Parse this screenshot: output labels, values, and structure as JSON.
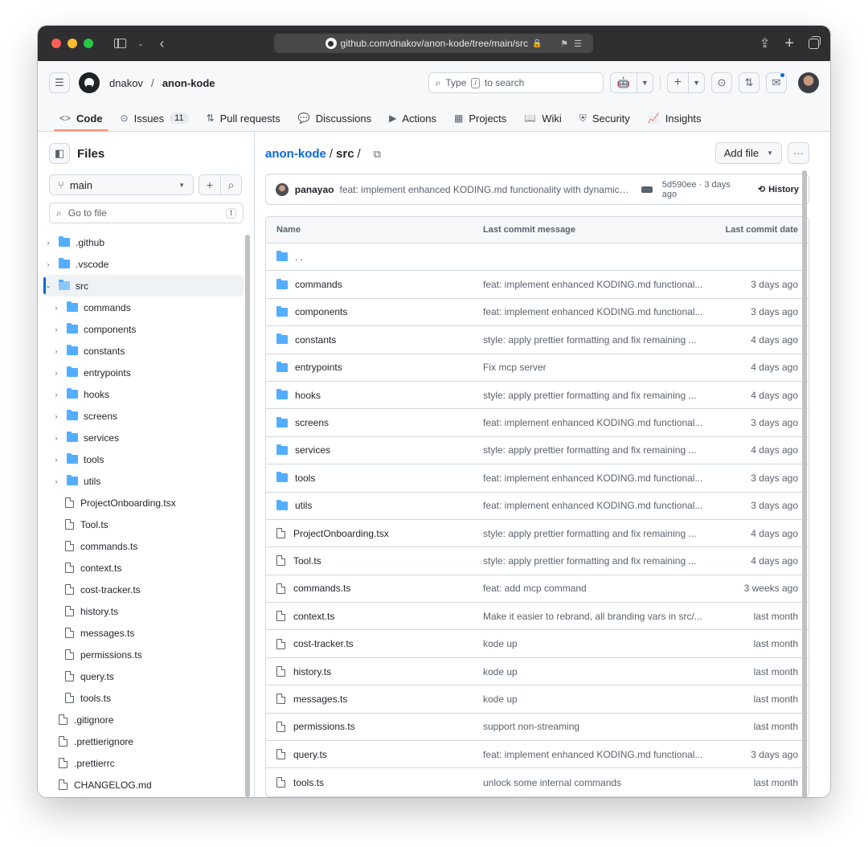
{
  "browser": {
    "url": "github.com/dnakov/anon-kode/tree/main/src"
  },
  "header": {
    "owner": "dnakov",
    "separator": "/",
    "repo": "anon-kode",
    "search_prefix": "Type",
    "search_key": "/",
    "search_suffix": "to search"
  },
  "repo_nav": [
    {
      "label": "Code",
      "icon": "<>"
    },
    {
      "label": "Issues",
      "icon": "⊙",
      "count": "11"
    },
    {
      "label": "Pull requests",
      "icon": "⇅"
    },
    {
      "label": "Discussions",
      "icon": "💬"
    },
    {
      "label": "Actions",
      "icon": "▶"
    },
    {
      "label": "Projects",
      "icon": "▦"
    },
    {
      "label": "Wiki",
      "icon": "📖"
    },
    {
      "label": "Security",
      "icon": "⛨"
    },
    {
      "label": "Insights",
      "icon": "📈"
    }
  ],
  "sidebar": {
    "title": "Files",
    "branch": "main",
    "goto_placeholder": "Go to file",
    "goto_key": "t",
    "tree": [
      {
        "name": ".github",
        "type": "folder",
        "depth": 0,
        "expanded": false
      },
      {
        "name": ".vscode",
        "type": "folder",
        "depth": 0,
        "expanded": false
      },
      {
        "name": "src",
        "type": "folder",
        "depth": 0,
        "expanded": true,
        "selected": true
      },
      {
        "name": "commands",
        "type": "folder",
        "depth": 1
      },
      {
        "name": "components",
        "type": "folder",
        "depth": 1
      },
      {
        "name": "constants",
        "type": "folder",
        "depth": 1
      },
      {
        "name": "entrypoints",
        "type": "folder",
        "depth": 1
      },
      {
        "name": "hooks",
        "type": "folder",
        "depth": 1
      },
      {
        "name": "screens",
        "type": "folder",
        "depth": 1
      },
      {
        "name": "services",
        "type": "folder",
        "depth": 1
      },
      {
        "name": "tools",
        "type": "folder",
        "depth": 1
      },
      {
        "name": "utils",
        "type": "folder",
        "depth": 1
      },
      {
        "name": "ProjectOnboarding.tsx",
        "type": "file",
        "depth": 1
      },
      {
        "name": "Tool.ts",
        "type": "file",
        "depth": 1
      },
      {
        "name": "commands.ts",
        "type": "file",
        "depth": 1
      },
      {
        "name": "context.ts",
        "type": "file",
        "depth": 1
      },
      {
        "name": "cost-tracker.ts",
        "type": "file",
        "depth": 1
      },
      {
        "name": "history.ts",
        "type": "file",
        "depth": 1
      },
      {
        "name": "messages.ts",
        "type": "file",
        "depth": 1
      },
      {
        "name": "permissions.ts",
        "type": "file",
        "depth": 1
      },
      {
        "name": "query.ts",
        "type": "file",
        "depth": 1
      },
      {
        "name": "tools.ts",
        "type": "file",
        "depth": 1
      },
      {
        "name": ".gitignore",
        "type": "file",
        "depth": 0
      },
      {
        "name": ".prettierignore",
        "type": "file",
        "depth": 0
      },
      {
        "name": ".prettierrc",
        "type": "file",
        "depth": 0
      },
      {
        "name": "CHANGELOG.md",
        "type": "file",
        "depth": 0
      }
    ]
  },
  "main": {
    "breadcrumb_repo": "anon-kode",
    "breadcrumb_sep": "/",
    "breadcrumb_current": "src",
    "breadcrumb_trail": "/",
    "add_file_label": "Add file",
    "commit": {
      "author": "panayao",
      "message": "feat: implement enhanced KODING.md functionality with dynamic…",
      "sha_and_time": "5d590ee · 3 days ago",
      "history_label": "History"
    },
    "columns": {
      "name": "Name",
      "message": "Last commit message",
      "date": "Last commit date"
    },
    "parent_dir": ". .",
    "rows": [
      {
        "name": "commands",
        "type": "folder",
        "message": "feat: implement enhanced KODING.md functional...",
        "date": "3 days ago"
      },
      {
        "name": "components",
        "type": "folder",
        "message": "feat: implement enhanced KODING.md functional...",
        "date": "3 days ago"
      },
      {
        "name": "constants",
        "type": "folder",
        "message": "style: apply prettier formatting and fix remaining ...",
        "date": "4 days ago"
      },
      {
        "name": "entrypoints",
        "type": "folder",
        "message": "Fix mcp server",
        "date": "4 days ago"
      },
      {
        "name": "hooks",
        "type": "folder",
        "message": "style: apply prettier formatting and fix remaining ...",
        "date": "4 days ago"
      },
      {
        "name": "screens",
        "type": "folder",
        "message": "feat: implement enhanced KODING.md functional...",
        "date": "3 days ago"
      },
      {
        "name": "services",
        "type": "folder",
        "message": "style: apply prettier formatting and fix remaining ...",
        "date": "4 days ago"
      },
      {
        "name": "tools",
        "type": "folder",
        "message": "feat: implement enhanced KODING.md functional...",
        "date": "3 days ago"
      },
      {
        "name": "utils",
        "type": "folder",
        "message": "feat: implement enhanced KODING.md functional...",
        "date": "3 days ago"
      },
      {
        "name": "ProjectOnboarding.tsx",
        "type": "file",
        "message": "style: apply prettier formatting and fix remaining ...",
        "date": "4 days ago"
      },
      {
        "name": "Tool.ts",
        "type": "file",
        "message": "style: apply prettier formatting and fix remaining ...",
        "date": "4 days ago"
      },
      {
        "name": "commands.ts",
        "type": "file",
        "message": "feat: add mcp command",
        "date": "3 weeks ago"
      },
      {
        "name": "context.ts",
        "type": "file",
        "message": "Make it easier to rebrand, all branding vars in src/...",
        "date": "last month"
      },
      {
        "name": "cost-tracker.ts",
        "type": "file",
        "message": "kode up",
        "date": "last month"
      },
      {
        "name": "history.ts",
        "type": "file",
        "message": "kode up",
        "date": "last month"
      },
      {
        "name": "messages.ts",
        "type": "file",
        "message": "kode up",
        "date": "last month"
      },
      {
        "name": "permissions.ts",
        "type": "file",
        "message": "support non-streaming",
        "date": "last month"
      },
      {
        "name": "query.ts",
        "type": "file",
        "message": "feat: implement enhanced KODING.md functional...",
        "date": "3 days ago"
      },
      {
        "name": "tools.ts",
        "type": "file",
        "message": "unlock some internal commands",
        "date": "last month"
      }
    ]
  },
  "colors": {
    "accent": "#0969da",
    "folder": "#54aeff",
    "active_tab_underline": "#fd8c73",
    "notification_dot": "#0969da"
  }
}
